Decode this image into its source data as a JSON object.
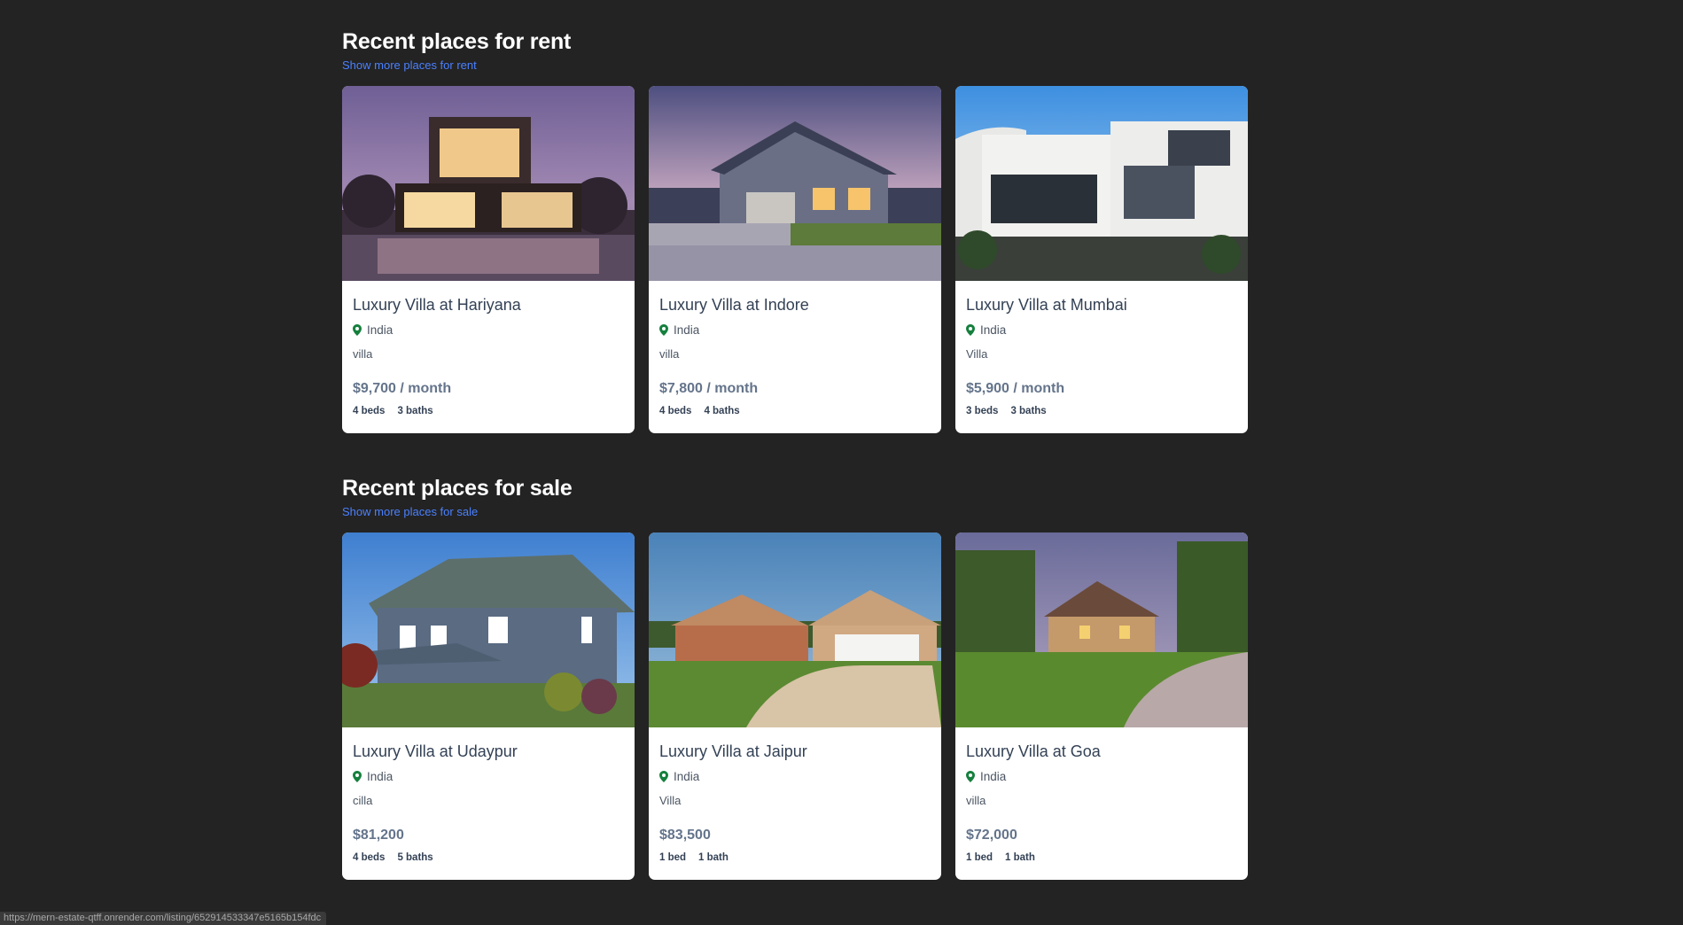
{
  "rent": {
    "title": "Recent places for rent",
    "link": "Show more places for rent",
    "cards": [
      {
        "title": "Luxury Villa at Hariyana",
        "location": "India",
        "type": "villa",
        "price": "$9,700 / month",
        "beds": "4 beds",
        "baths": "3 baths"
      },
      {
        "title": "Luxury Villa at Indore",
        "location": "India",
        "type": "villa",
        "price": "$7,800 / month",
        "beds": "4 beds",
        "baths": "4 baths"
      },
      {
        "title": "Luxury Villa at Mumbai",
        "location": "India",
        "type": "Villa",
        "price": "$5,900 / month",
        "beds": "3 beds",
        "baths": "3 baths"
      }
    ]
  },
  "sale": {
    "title": "Recent places for sale",
    "link": "Show more places for sale",
    "cards": [
      {
        "title": "Luxury Villa at Udaypur",
        "location": "India",
        "type": "cilla",
        "price": "$81,200",
        "beds": "4 beds",
        "baths": "5 baths"
      },
      {
        "title": "Luxury Villa at Jaipur",
        "location": "India",
        "type": "Villa",
        "price": "$83,500",
        "beds": "1 bed",
        "baths": "1 bath"
      },
      {
        "title": "Luxury Villa at Goa",
        "location": "India",
        "type": "villa",
        "price": "$72,000",
        "beds": "1 bed",
        "baths": "1 bath"
      }
    ]
  },
  "status_url": "https://mern-estate-qtff.onrender.com/listing/652914533347e5165b154fdc",
  "icons": {
    "location": "map-pin-icon"
  },
  "colors": {
    "background": "#232323",
    "link": "#4a80ff",
    "pin": "#15803d",
    "title": "#334155"
  }
}
